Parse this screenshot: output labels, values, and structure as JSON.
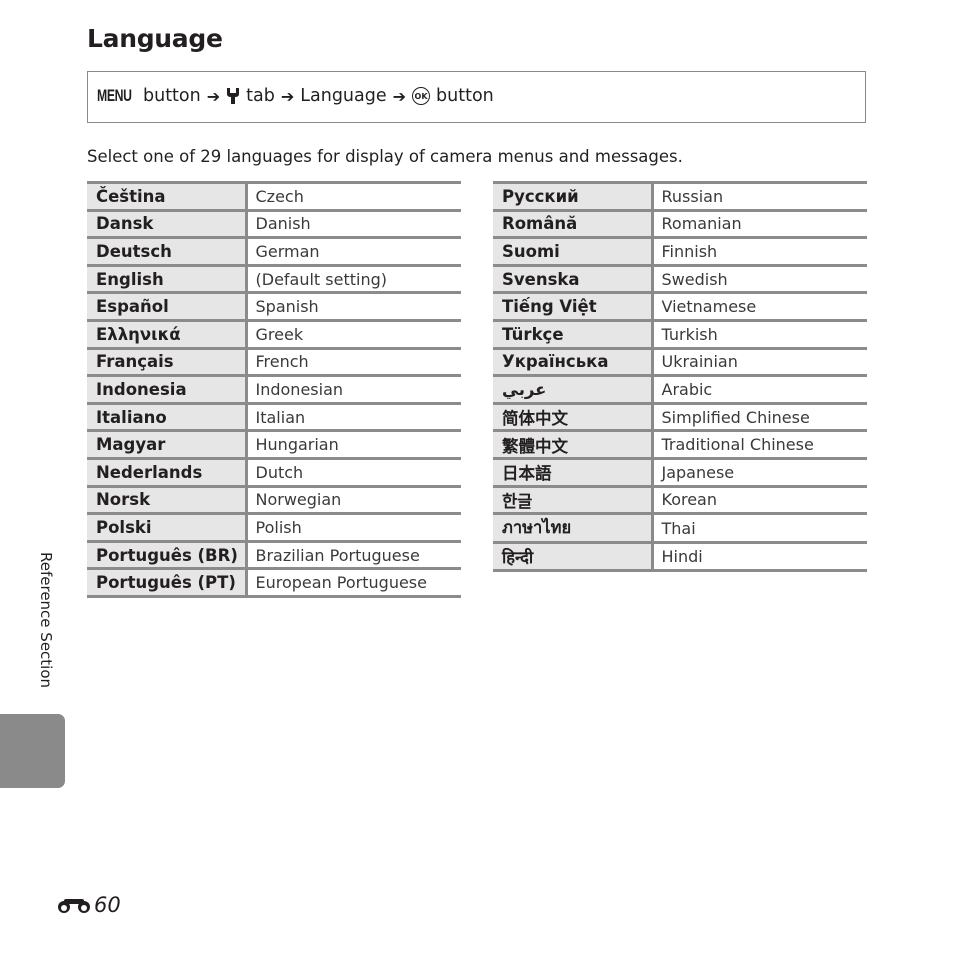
{
  "page": {
    "title": "Language",
    "nav_path": {
      "menu_label": "MENU",
      "step1": "button",
      "wrench_icon": "setup-wrench-icon",
      "step2": "tab",
      "step3": "Language",
      "ok_label": "OK",
      "step4": "button",
      "arrow": "➔"
    },
    "intro": "Select one of 29 languages for display of camera menus and messages.",
    "side_label": "Reference Section",
    "page_number": "60",
    "page_prefix_icon": "binoculars-icon"
  },
  "languages_left": [
    {
      "native": "Čeština",
      "english": "Czech"
    },
    {
      "native": "Dansk",
      "english": "Danish"
    },
    {
      "native": "Deutsch",
      "english": "German"
    },
    {
      "native": "English",
      "english": "(Default setting)"
    },
    {
      "native": "Español",
      "english": "Spanish"
    },
    {
      "native": "Ελληνικά",
      "english": "Greek"
    },
    {
      "native": "Français",
      "english": "French"
    },
    {
      "native": "Indonesia",
      "english": "Indonesian"
    },
    {
      "native": "Italiano",
      "english": "Italian"
    },
    {
      "native": "Magyar",
      "english": "Hungarian"
    },
    {
      "native": "Nederlands",
      "english": "Dutch"
    },
    {
      "native": "Norsk",
      "english": "Norwegian"
    },
    {
      "native": "Polski",
      "english": "Polish"
    },
    {
      "native": "Português (BR)",
      "english": "Brazilian Portuguese"
    },
    {
      "native": "Português (PT)",
      "english": "European Portuguese"
    }
  ],
  "languages_right": [
    {
      "native": "Русский",
      "english": "Russian"
    },
    {
      "native": "Română",
      "english": "Romanian"
    },
    {
      "native": "Suomi",
      "english": "Finnish"
    },
    {
      "native": "Svenska",
      "english": "Swedish"
    },
    {
      "native": "Tiếng Việt",
      "english": "Vietnamese"
    },
    {
      "native": "Türkçe",
      "english": "Turkish"
    },
    {
      "native": "Українська",
      "english": "Ukrainian"
    },
    {
      "native": "عربي",
      "english": "Arabic"
    },
    {
      "native": "简体中文",
      "english": "Simplified Chinese"
    },
    {
      "native": "繁體中文",
      "english": "Traditional Chinese"
    },
    {
      "native": "日本語",
      "english": "Japanese"
    },
    {
      "native": "한글",
      "english": "Korean"
    },
    {
      "native": "ภาษาไทย",
      "english": "Thai"
    },
    {
      "native": "हिन्दी",
      "english": "Hindi"
    }
  ],
  "colors": {
    "border": "#8b8b8b",
    "native_cell_bg": "#e6e6e6",
    "side_tab": "#8a8a8a",
    "text": "#231f20"
  }
}
